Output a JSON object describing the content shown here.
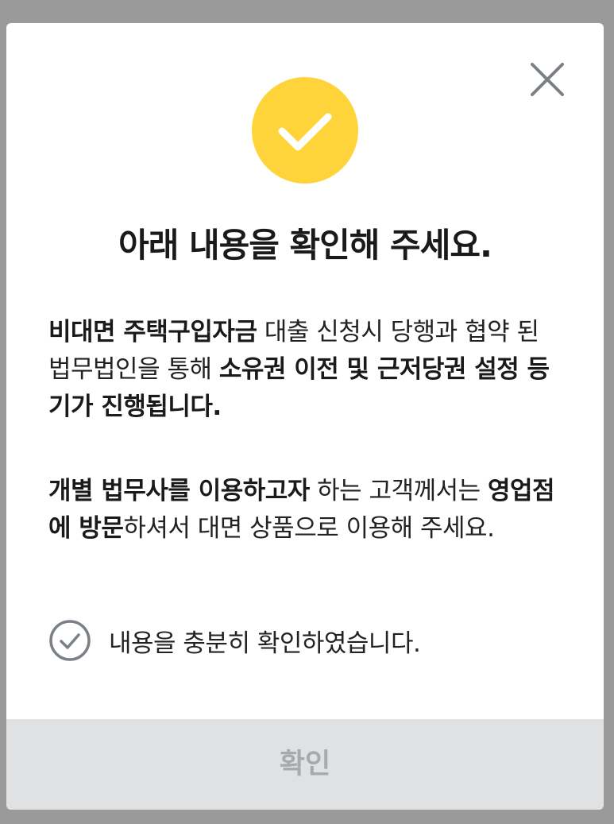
{
  "modal": {
    "title": "아래 내용을 확인해 주세요.",
    "paragraph1": {
      "bold1": "비대면 주택구입자금",
      "text1": " 대출 신청시 당행과 협약 된 법무법인을 통해 ",
      "bold2": "소유권 이전 및 근저당권 설정 등기가 진행됩니다."
    },
    "paragraph2": {
      "bold1": "개별 법무사를 이용하고자",
      "text1": " 하는 고객께서는 ",
      "bold2": "영업점에 방문",
      "text2": "하셔서 대면 상품으로 이용해 주세요."
    },
    "agree_label": "내용을 충분히 확인하였습니다.",
    "confirm_label": "확인"
  },
  "colors": {
    "accent": "#ffd43b",
    "disabled_button_bg": "#dfe1e3",
    "disabled_button_text": "#a7aaad",
    "overlay": "#9a9a9a"
  },
  "icons": {
    "close": "close-icon",
    "success": "check-icon",
    "agree": "check-circle-icon"
  }
}
